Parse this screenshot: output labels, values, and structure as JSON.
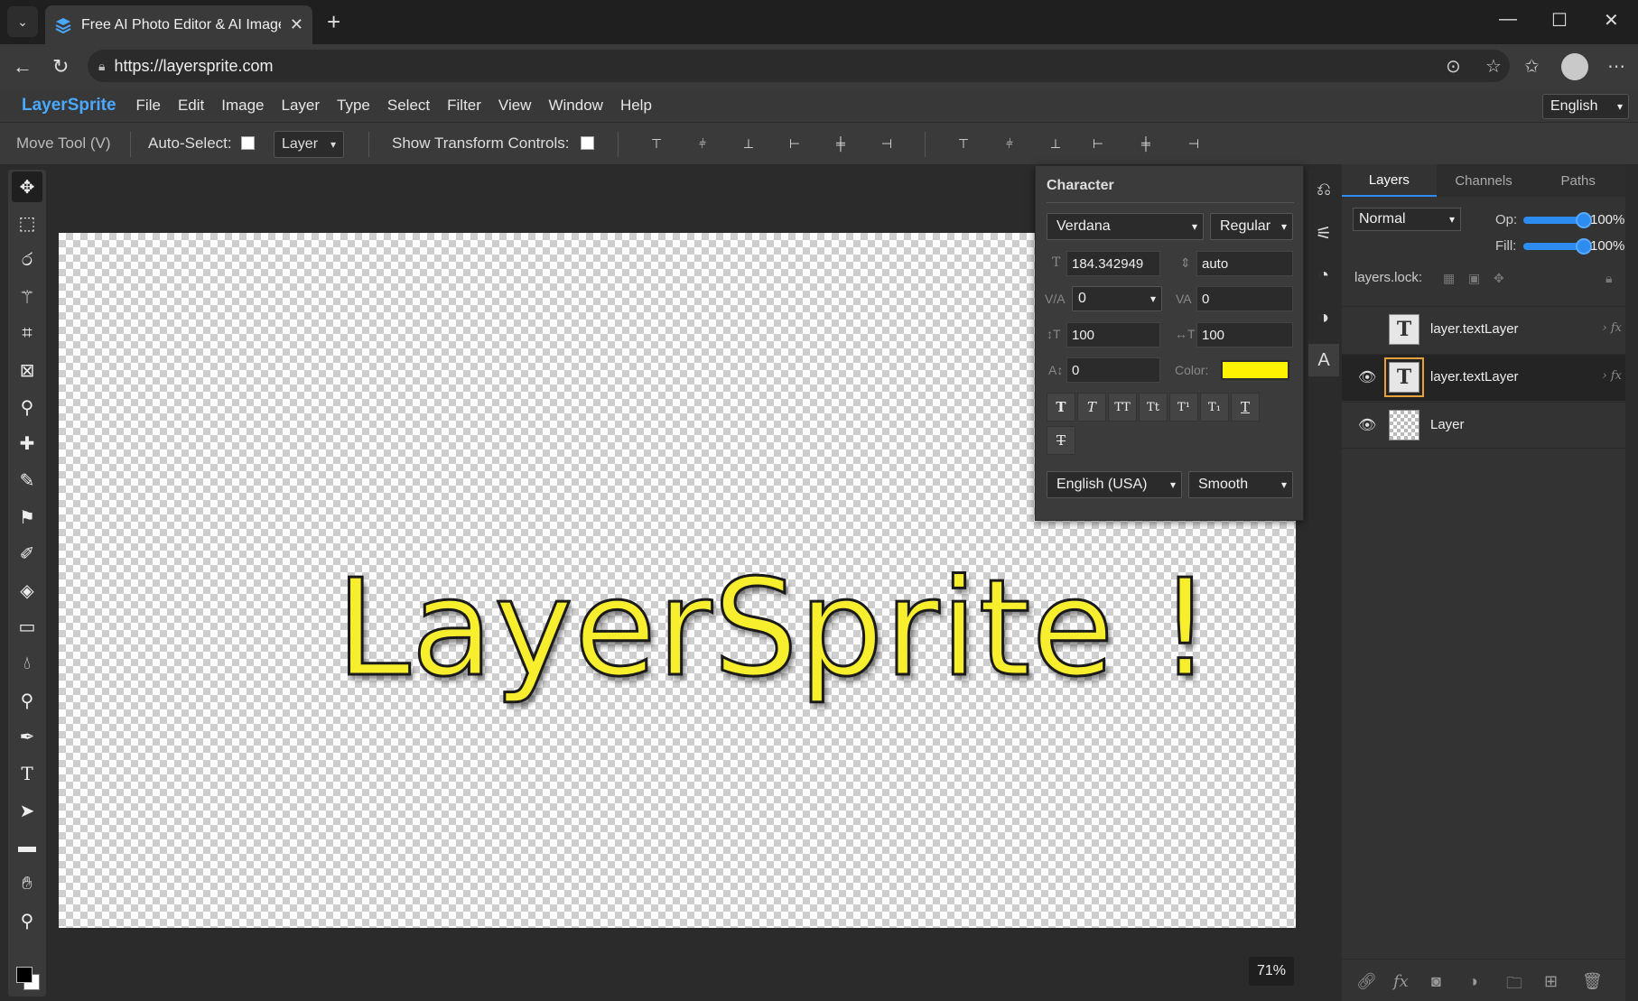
{
  "browser": {
    "tab_title": "Free AI Photo Editor & AI Image Editor",
    "url": "https://layersprite.com"
  },
  "app": {
    "brand": "LayerSprite",
    "menu": [
      "File",
      "Edit",
      "Image",
      "Layer",
      "Type",
      "Select",
      "Filter",
      "View",
      "Window",
      "Help"
    ],
    "language": "English"
  },
  "options": {
    "tool_name": "Move Tool (V)",
    "auto_select_label": "Auto-Select:",
    "auto_select_target": "Layer",
    "show_transform_label": "Show Transform Controls:"
  },
  "canvas": {
    "text": "LayerSprite !",
    "zoom": "71%"
  },
  "character": {
    "title": "Character",
    "font_family": "Verdana",
    "font_style": "Regular",
    "font_size": "184.342949",
    "leading": "auto",
    "kerning": "0",
    "tracking": "0",
    "vertical_scale": "100",
    "horizontal_scale": "100",
    "baseline_shift": "0",
    "color_label": "Color:",
    "color": "#fff200",
    "language": "English (USA)",
    "antialias": "Smooth",
    "labels": {
      "size": "T",
      "leading": "⇕",
      "kerning": "V/A",
      "tracking": "VA",
      "vscale": "↕T",
      "hscale": "↔T",
      "baseline": "A↕"
    },
    "style_buttons": [
      "T",
      "T",
      "TT",
      "Tt",
      "T¹",
      "T₁",
      "T",
      "T"
    ]
  },
  "layers_panel": {
    "tabs": [
      "Layers",
      "Channels",
      "Paths"
    ],
    "blend_mode": "Normal",
    "opacity_label": "Op:",
    "opacity": "100%",
    "fill_label": "Fill:",
    "fill": "100%",
    "lock_label": "layers.lock:",
    "layers": [
      {
        "name": "layer.textLayer",
        "visible": false,
        "selected": false,
        "thumb": "T"
      },
      {
        "name": "layer.textLayer",
        "visible": true,
        "selected": true,
        "thumb": "T"
      },
      {
        "name": "Layer",
        "visible": true,
        "selected": false,
        "thumb": ""
      }
    ]
  }
}
